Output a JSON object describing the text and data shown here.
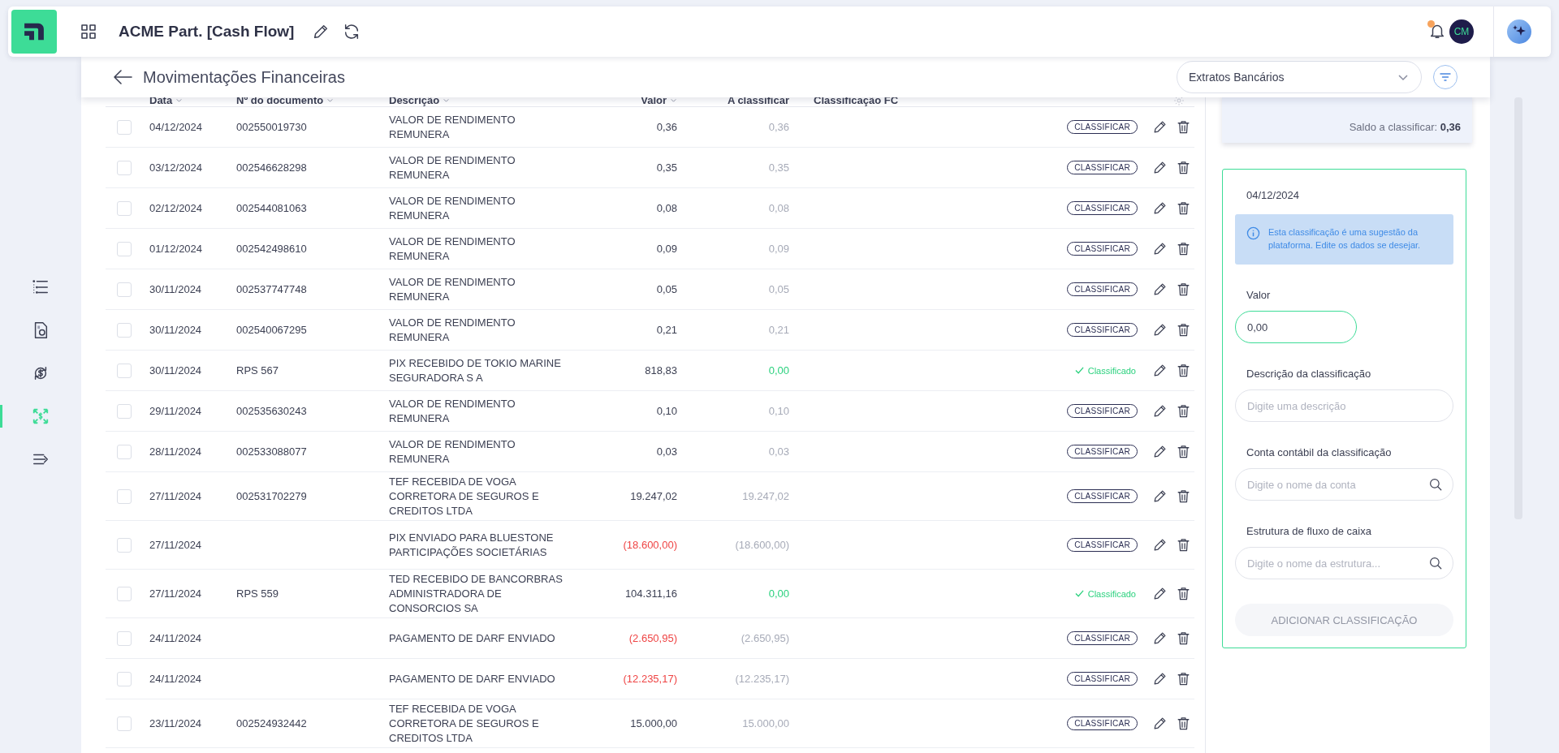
{
  "app": {
    "title": "ACME Part. [Cash Flow]",
    "avatar": "CM",
    "notification": true
  },
  "sidebar": {
    "items": [
      {
        "kind": "list",
        "selected": false
      },
      {
        "kind": "report",
        "selected": false
      },
      {
        "kind": "exchange",
        "selected": false
      },
      {
        "kind": "reconcile",
        "selected": true
      },
      {
        "kind": "export",
        "selected": false
      }
    ]
  },
  "page": {
    "title": "Movimentações Financeiras",
    "source": "Extratos Bancários"
  },
  "table": {
    "columns": [
      "Data",
      "Nº do documento",
      "Descrição",
      "Valor",
      "A classificar",
      "Classificação FC"
    ],
    "rows": [
      {
        "date": "04/12/2024",
        "document": "002550019730",
        "description": "VALOR DE RENDIMENTO REMUNERA",
        "value": "0,36",
        "pending": "0,36",
        "negative": false,
        "classified": false,
        "status": "CLASSIFICAR",
        "checked": false
      },
      {
        "date": "03/12/2024",
        "document": "002546628298",
        "description": "VALOR DE RENDIMENTO REMUNERA",
        "value": "0,35",
        "pending": "0,35",
        "negative": false,
        "classified": false,
        "status": "CLASSIFICAR",
        "checked": false
      },
      {
        "date": "02/12/2024",
        "document": "002544081063",
        "description": "VALOR DE RENDIMENTO REMUNERA",
        "value": "0,08",
        "pending": "0,08",
        "negative": false,
        "classified": false,
        "status": "CLASSIFICAR",
        "checked": false
      },
      {
        "date": "01/12/2024",
        "document": "002542498610",
        "description": "VALOR DE RENDIMENTO REMUNERA",
        "value": "0,09",
        "pending": "0,09",
        "negative": false,
        "classified": false,
        "status": "CLASSIFICAR",
        "checked": false
      },
      {
        "date": "30/11/2024",
        "document": "002537747748",
        "description": "VALOR DE RENDIMENTO REMUNERA",
        "value": "0,05",
        "pending": "0,05",
        "negative": false,
        "classified": false,
        "status": "CLASSIFICAR",
        "checked": false
      },
      {
        "date": "30/11/2024",
        "document": "002540067295",
        "description": "VALOR DE RENDIMENTO REMUNERA",
        "value": "0,21",
        "pending": "0,21",
        "negative": false,
        "classified": false,
        "status": "CLASSIFICAR",
        "checked": false
      },
      {
        "date": "30/11/2024",
        "document": "RPS 567",
        "description": "PIX RECEBIDO DE TOKIO MARINE SEGURADORA S A",
        "value": "818,83",
        "pending": "0,00",
        "negative": false,
        "classified": true,
        "status": "Classificado",
        "checked": false
      },
      {
        "date": "29/11/2024",
        "document": "002535630243",
        "description": "VALOR DE RENDIMENTO REMUNERA",
        "value": "0,10",
        "pending": "0,10",
        "negative": false,
        "classified": false,
        "status": "CLASSIFICAR",
        "checked": false
      },
      {
        "date": "28/11/2024",
        "document": "002533088077",
        "description": "VALOR DE RENDIMENTO REMUNERA",
        "value": "0,03",
        "pending": "0,03",
        "negative": false,
        "classified": false,
        "status": "CLASSIFICAR",
        "checked": false
      },
      {
        "date": "27/11/2024",
        "document": "002531702279",
        "description": "TEF RECEBIDA DE VOGA CORRETORA DE SEGUROS E CREDITOS LTDA",
        "value": "19.247,02",
        "pending": "19.247,02",
        "negative": false,
        "classified": false,
        "status": "CLASSIFICAR",
        "checked": false
      },
      {
        "date": "27/11/2024",
        "description": "PIX ENVIADO PARA BLUESTONE PARTICIPAÇÕES SOCIETÁRIAS",
        "value": "(18.600,00)",
        "pending": "(18.600,00)",
        "negative": true,
        "classified": false,
        "status": "CLASSIFICAR",
        "checked": false
      },
      {
        "date": "27/11/2024",
        "document": "RPS 559",
        "description": "TED RECEBIDO DE BANCORBRAS ADMINISTRADORA DE CONSORCIOS SA",
        "value": "104.311,16",
        "pending": "0,00",
        "negative": false,
        "classified": true,
        "status": "Classificado",
        "checked": false
      },
      {
        "date": "24/11/2024",
        "description": "PAGAMENTO DE DARF ENVIADO",
        "value": "(2.650,95)",
        "pending": "(2.650,95)",
        "negative": true,
        "classified": false,
        "status": "CLASSIFICAR",
        "checked": false
      },
      {
        "date": "24/11/2024",
        "description": "PAGAMENTO DE DARF ENVIADO",
        "value": "(12.235,17)",
        "pending": "(12.235,17)",
        "negative": true,
        "classified": false,
        "status": "CLASSIFICAR",
        "checked": false
      },
      {
        "date": "23/11/2024",
        "document": "002524932442",
        "description": "TEF RECEBIDA DE VOGA CORRETORA DE SEGUROS E CREDITOS LTDA",
        "value": "15.000,00",
        "pending": "15.000,00",
        "negative": false,
        "classified": false,
        "status": "CLASSIFICAR",
        "checked": false
      }
    ]
  },
  "summary": {
    "text": "Saldo a classificar: **0,36**"
  },
  "form": {
    "date": "04/12/2024",
    "info": "Esta classificação é uma sugestão da plataforma. Edite os dados se desejar.",
    "fields": [
      {
        "kind": "value",
        "label": "Valor",
        "value": "0,00"
      },
      {
        "kind": "text",
        "label": "Descrição da classificação",
        "placeholder": "Digite uma descrição"
      },
      {
        "kind": "search",
        "label": "Conta contábil da classificação",
        "placeholder": "Digite o nome da conta"
      },
      {
        "kind": "search",
        "label": "Estrutura de fluxo de caixa",
        "placeholder": "Digite o nome da estrutura..."
      }
    ],
    "submit": {
      "label": "ADICIONAR CLASSIFICAÇÃO",
      "disabled": true
    }
  }
}
